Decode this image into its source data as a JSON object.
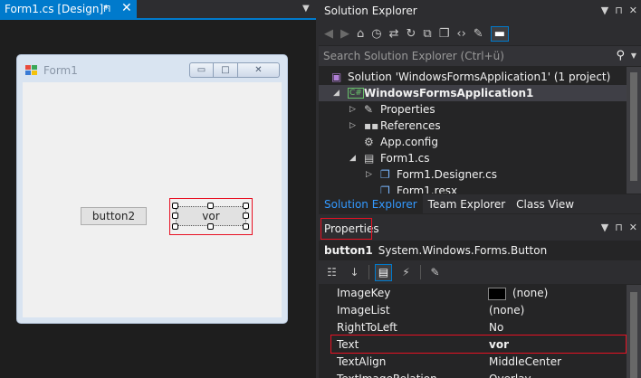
{
  "document": {
    "tab_title": "Form1.cs [Design]*",
    "pin_glyph": "⊓",
    "close_glyph": "✕"
  },
  "form": {
    "title": "Form1",
    "min_glyph": "▭",
    "max_glyph": "□",
    "close_glyph": "✕",
    "button2_label": "button2",
    "button1_label": "vor"
  },
  "solution_explorer": {
    "title": "Solution Explorer",
    "search_placeholder": "Search Solution Explorer (Ctrl+ü)",
    "tree": [
      {
        "label": "Solution 'WindowsFormsApplication1' (1 project)",
        "icon": "solution-icon",
        "level": 0,
        "arrow": "",
        "bold": false,
        "selected": false
      },
      {
        "label": "WindowsFormsApplication1",
        "icon": "csharp-project-icon",
        "level": 1,
        "arrow": "expanded",
        "bold": true,
        "selected": true
      },
      {
        "label": "Properties",
        "icon": "wrench-icon",
        "level": 2,
        "arrow": "collapsed",
        "bold": false,
        "selected": false
      },
      {
        "label": "References",
        "icon": "references-icon",
        "level": 2,
        "arrow": "collapsed",
        "bold": false,
        "selected": false
      },
      {
        "label": "App.config",
        "icon": "config-file-icon",
        "level": 2,
        "arrow": "",
        "bold": false,
        "selected": false
      },
      {
        "label": "Form1.cs",
        "icon": "form-icon",
        "level": 2,
        "arrow": "expanded",
        "bold": false,
        "selected": false
      },
      {
        "label": "Form1.Designer.cs",
        "icon": "cs-file-icon",
        "level": 3,
        "arrow": "collapsed",
        "bold": false,
        "selected": false
      },
      {
        "label": "Form1.resx",
        "icon": "resx-file-icon",
        "level": 3,
        "arrow": "",
        "bold": false,
        "selected": false
      }
    ],
    "tabs": [
      {
        "label": "Solution Explorer",
        "active": true
      },
      {
        "label": "Team Explorer",
        "active": false
      },
      {
        "label": "Class View",
        "active": false
      }
    ]
  },
  "properties": {
    "title": "Properties",
    "object_name": "button1",
    "object_type": "System.Windows.Forms.Button",
    "rows": [
      {
        "name": "ImageKey",
        "value": "(none)",
        "swatch": true,
        "bold": false
      },
      {
        "name": "ImageList",
        "value": "(none)",
        "swatch": false,
        "bold": false
      },
      {
        "name": "RightToLeft",
        "value": "No",
        "swatch": false,
        "bold": false
      },
      {
        "name": "Text",
        "value": "vor",
        "swatch": false,
        "bold": true
      },
      {
        "name": "TextAlign",
        "value": "MiddleCenter",
        "swatch": false,
        "bold": false
      },
      {
        "name": "TextImageRelation",
        "value": "Overlay",
        "swatch": false,
        "bold": false
      }
    ]
  },
  "colors": {
    "accent": "#007acc",
    "highlight_border": "#e81123",
    "panel_bg": "#252526",
    "chrome_bg": "#2d2d30"
  }
}
